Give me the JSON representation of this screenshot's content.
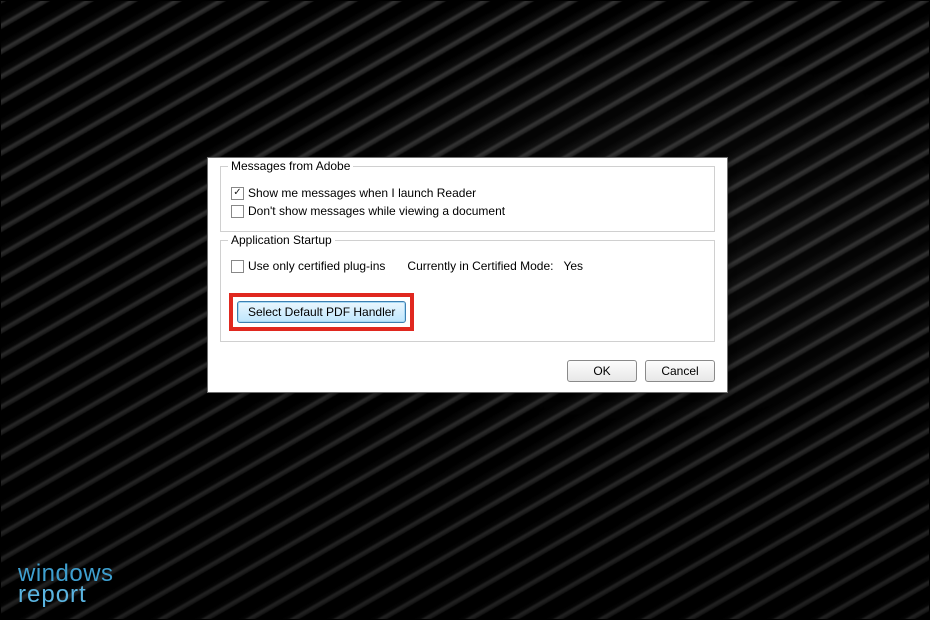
{
  "groups": {
    "messages": {
      "legend": "Messages from Adobe",
      "opt_show": "Show me messages when I launch Reader",
      "opt_hide": "Don't show messages while viewing a document"
    },
    "startup": {
      "legend": "Application Startup",
      "opt_certified": "Use only certified plug-ins",
      "mode_label": "Currently in Certified Mode:",
      "mode_value": "Yes",
      "select_handler": "Select Default PDF Handler"
    }
  },
  "buttons": {
    "ok": "OK",
    "cancel": "Cancel"
  },
  "watermark": {
    "line1": "windows",
    "line2": "report"
  }
}
